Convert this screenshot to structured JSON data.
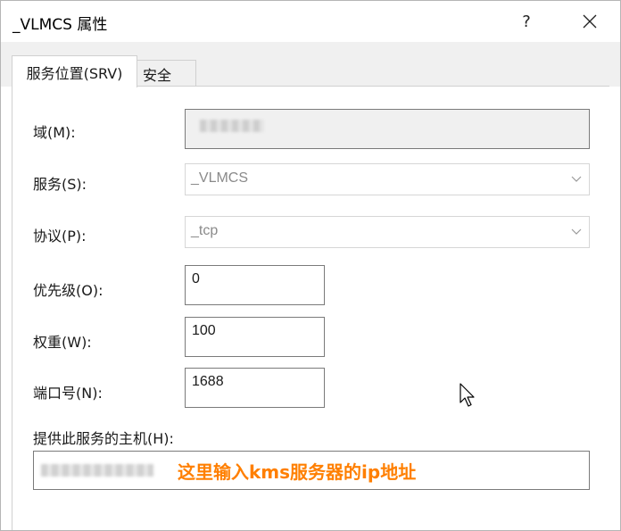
{
  "window": {
    "title": "_VLMCS 属性",
    "help_symbol": "?"
  },
  "tabs": [
    {
      "label": "服务位置(SRV)",
      "active": true
    },
    {
      "label": "安全",
      "active": false
    }
  ],
  "form": {
    "domain_label": "域(M):",
    "service_label": "服务(S):",
    "service_value": "_VLMCS",
    "protocol_label": "协议(P):",
    "protocol_value": "_tcp",
    "priority_label": "优先级(O):",
    "priority_value": "0",
    "weight_label": "权重(W):",
    "weight_value": "100",
    "port_label": "端口号(N):",
    "port_value": "1688",
    "host_label": "提供此服务的主机(H):",
    "host_annotation": "这里输入kms服务器的ip地址"
  },
  "icons": {
    "close": "close-icon",
    "dropdown": "chevron-down-icon",
    "cursor": "mouse-pointer-icon"
  },
  "colors": {
    "annotation": "#ff7f00",
    "tabbar_bg": "#f0f0f0",
    "readonly_bg": "#f0f0f0"
  }
}
